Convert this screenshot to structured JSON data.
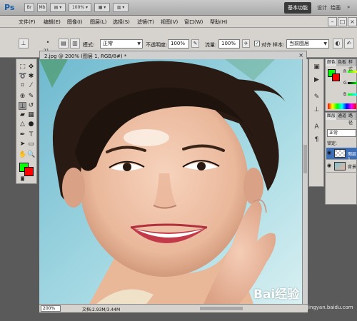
{
  "app": {
    "logo": "Ps",
    "title_buttons": [
      "Br",
      "Mb",
      "▤ ▾",
      "100% ▾",
      "▦ ▾",
      "▥ ▾"
    ],
    "workspace": "基本功能",
    "links": [
      "设计",
      "绘画",
      "»"
    ],
    "window_controls": [
      "–",
      "□",
      "×"
    ]
  },
  "menu": [
    "文件(F)",
    "编辑(E)",
    "图像(I)",
    "图层(L)",
    "选择(S)",
    "滤镜(T)",
    "视图(V)",
    "窗口(W)",
    "帮助(H)"
  ],
  "options": {
    "brush_size": "21",
    "mode_label": "模式:",
    "mode_value": "正常",
    "opacity_label": "不透明度:",
    "opacity_value": "100%",
    "flow_label": "流量:",
    "flow_value": "100%",
    "aligned_label": "对齐",
    "aligned_checked": true,
    "sample_label": "样本:",
    "sample_value": "当前图层"
  },
  "document": {
    "tab_title": "2.jpg @ 200% (图层 1, RGB/8#) *",
    "zoom": "200%",
    "doc_info": "文档:2.93M/3.44M"
  },
  "colors": {
    "foreground": "#00ff00",
    "background": "#ff0000"
  },
  "panels": {
    "color_tabs": [
      "颜色",
      "色板",
      "样式"
    ],
    "color_channels": [
      "R",
      "G",
      "B"
    ],
    "layer_tabs": [
      "图层",
      "通道",
      "路径"
    ],
    "blend_mode": "正常",
    "lock_label": "锁定:",
    "layers": [
      {
        "name": "图层 1",
        "selected": true,
        "thumb": "checker"
      },
      {
        "name": "背景",
        "selected": false,
        "thumb": "photo"
      }
    ]
  },
  "watermark": {
    "text": "Bai经验",
    "sub": "jingyan.baidu.com"
  }
}
